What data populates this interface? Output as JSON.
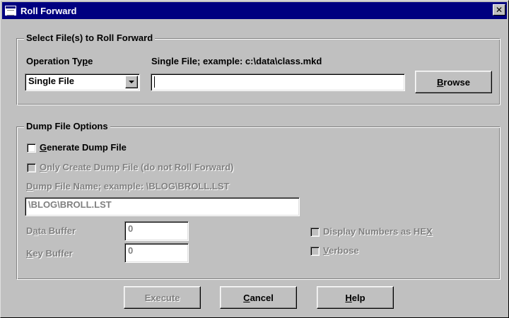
{
  "window": {
    "title": "Roll Forward",
    "close_glyph": "✕"
  },
  "select_group": {
    "legend": "Select File(s) to Roll Forward",
    "operation_type_pre": "Operation Ty",
    "operation_type_key": "p",
    "operation_type_post": "e",
    "single_file_label": "Single File; example: c:\\data\\class.mkd",
    "operation_type_value": "Single File",
    "file_path_value": "",
    "browse_key": "B",
    "browse_rest": "rowse"
  },
  "dump_group": {
    "legend": "Dump File Options",
    "generate_key": "G",
    "generate_rest": "enerate Dump File",
    "generate_checked": false,
    "only_create_key": "O",
    "only_create_rest": "nly Create Dump File (do not Roll Forward)",
    "only_create_checked": false,
    "dump_name_key": "D",
    "dump_name_rest": "ump File Name; example: \\BLOG\\BROLL.LST",
    "dump_name_value": "\\BLOG\\BROLL.LST",
    "data_buffer_pre": "D",
    "data_buffer_key": "a",
    "data_buffer_post": "ta Buffer",
    "data_buffer_value": "0",
    "key_buffer_key": "K",
    "key_buffer_rest": "ey Buffer",
    "key_buffer_value": "0",
    "hex_pre": "Display Numbers as HE",
    "hex_key": "X",
    "hex_checked": false,
    "verbose_key": "V",
    "verbose_rest": "erbose",
    "verbose_checked": false
  },
  "buttons": {
    "execute": "Execute",
    "cancel_key": "C",
    "cancel_rest": "ancel",
    "help_key": "H",
    "help_rest": "elp"
  },
  "colors": {
    "titlebar": "#000080",
    "face": "#c0c0c0",
    "disabled_text": "#808080"
  }
}
